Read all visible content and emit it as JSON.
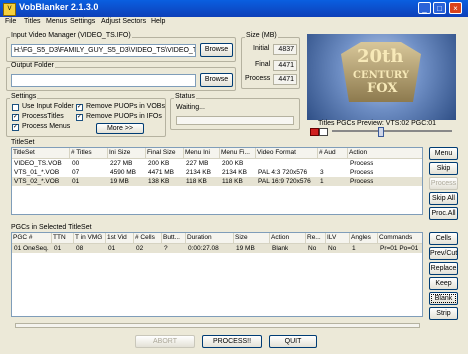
{
  "window": {
    "title": "VobBlanker 2.1.3.0"
  },
  "menu": [
    "File",
    "Titles",
    "Menus",
    "Settings",
    "Adjust Sectors",
    "Help"
  ],
  "input_group": {
    "label": "Input Video Manager (VIDEO_TS.IFO)",
    "value": "H:\\FG_S5_D3\\FAMILY_GUY_S5_D3\\VIDEO_TS\\VIDEO_TS.I",
    "browse": "Browse"
  },
  "output_group": {
    "label": "Output Folder",
    "value": "",
    "browse": "Browse"
  },
  "size_group": {
    "label": "Size (MB)",
    "initial_label": "Initial",
    "initial": "4837",
    "final_label": "Final",
    "final": "4471",
    "process_label": "Process",
    "process": "4471"
  },
  "preview": {
    "logo_top": "20th",
    "logo_mid": "CENTURY",
    "logo_bot": "FOX",
    "caption": "Titles PGCs Preview: VTS:02 PGC:01"
  },
  "settings": {
    "label": "Settings",
    "use_input_folder": "Use Input Folder",
    "process_titles": "ProcessTitles",
    "process_menus": "Process Menus",
    "remove_vobs": "Remove PUOPs in VOBs",
    "remove_ifos": "Remove PUOPs in IFOs",
    "more": "More >>"
  },
  "status": {
    "label": "Status",
    "text": "Waiting..."
  },
  "titleset": {
    "label": "TitleSet",
    "headers": [
      "TitleSet",
      "# Titles",
      "Ini Size",
      "Final Size",
      "Menu Ini",
      "Menu Fi...",
      "Video Format",
      "# Aud",
      "Action"
    ],
    "rows": [
      [
        "VIDEO_TS.VOB",
        "00",
        "227 MB",
        "200 KB",
        "227 MB",
        "200 KB",
        "",
        "",
        "Process"
      ],
      [
        "VTS_01_*.VOB",
        "07",
        "4590 MB",
        "4471 MB",
        "2134 KB",
        "2134 KB",
        "PAL   4:3 720x576",
        "3",
        "Process"
      ],
      [
        "VTS_02_*.VOB",
        "01",
        "19 MB",
        "138 KB",
        "118 KB",
        "118 KB",
        "PAL  16:9 720x576",
        "1",
        "Process"
      ]
    ],
    "buttons": [
      "Menu",
      "Skip",
      "Process",
      "Skip All",
      "Proc.All"
    ]
  },
  "pgcs": {
    "label": "PGCs in Selected TitleSet",
    "headers": [
      "PGC #",
      "TTN",
      "T in VMG",
      "1st Vid",
      "# Cells",
      "Butt...",
      "Duration",
      "Size",
      "Action",
      "Re...",
      "ILV",
      "Angles",
      "Commands"
    ],
    "rows": [
      [
        "01 OneSeq.",
        "01",
        "08",
        "01",
        "02",
        "?",
        "0:00:27.08",
        "19 MB",
        "Blank",
        "No",
        "No",
        "1",
        "Pr=01 Po=01"
      ]
    ],
    "buttons": [
      "Cells",
      "Prev/Cut",
      "Replace",
      "Keep",
      "Blank",
      "Strip"
    ]
  },
  "bottom": {
    "abort": "ABORT",
    "process": "PROCESS!!",
    "quit": "QUIT"
  },
  "colors": {
    "title_bar": "#0d3fb8",
    "panel_bg": "#ece9d8",
    "preview_bg": "#4a6ea8"
  }
}
